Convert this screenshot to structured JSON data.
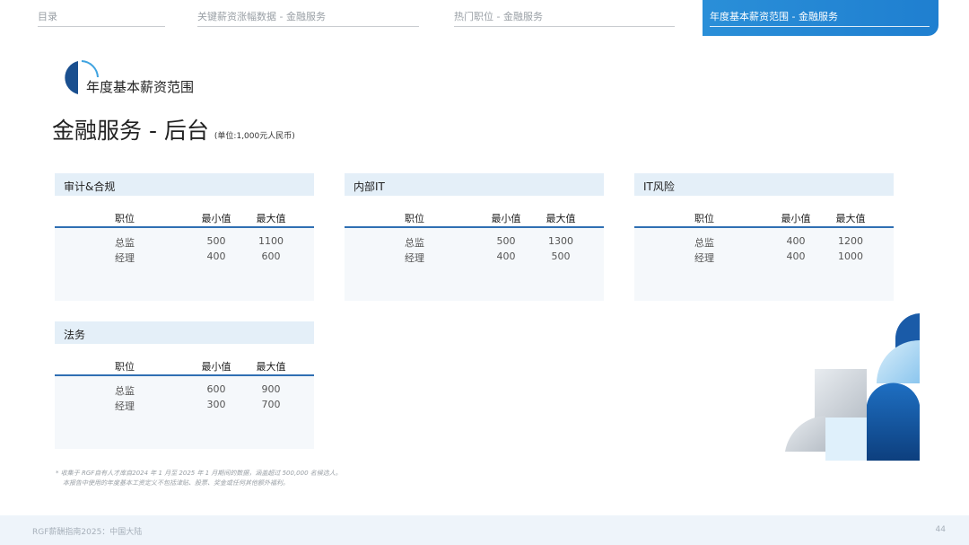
{
  "nav": {
    "tabs": [
      {
        "label": "目录"
      },
      {
        "label": "关键薪资涨幅数据 - 金融服务"
      },
      {
        "label": "热门职位 - 金融服务"
      },
      {
        "label": "年度基本薪资范围 - 金融服务"
      }
    ]
  },
  "section": {
    "title": "年度基本薪资范围"
  },
  "page": {
    "title": "金融服务 - 后台",
    "unit": "(单位:1,000元人民币)"
  },
  "columns": {
    "role": "职位",
    "min": "最小值",
    "max": "最大值"
  },
  "cards": [
    {
      "title": "审计&合规",
      "rows": [
        {
          "role": "总监",
          "min": "500",
          "max": "1100"
        },
        {
          "role": "经理",
          "min": "400",
          "max": "600"
        }
      ]
    },
    {
      "title": "内部IT",
      "rows": [
        {
          "role": "总监",
          "min": "500",
          "max": "1300"
        },
        {
          "role": "经理",
          "min": "400",
          "max": "500"
        }
      ]
    },
    {
      "title": "IT风险",
      "rows": [
        {
          "role": "总监",
          "min": "400",
          "max": "1200"
        },
        {
          "role": "经理",
          "min": "400",
          "max": "1000"
        }
      ]
    },
    {
      "title": "法务",
      "rows": [
        {
          "role": "总监",
          "min": "600",
          "max": "900"
        },
        {
          "role": "经理",
          "min": "300",
          "max": "700"
        }
      ]
    }
  ],
  "footnote": {
    "line1": "* 收集于 RGF自有人才库自2024 年 1 月至 2025 年 1 月期间的数据，涵盖超过 500,000 名候选人。",
    "line2": "本报告中使用的年度基本工资定义不包括津贴、股票、奖金或任何其他额外福利。"
  },
  "footer": {
    "text": "RGF薪酬指南2025：中国大陆",
    "page_number": "44"
  },
  "colors": {
    "accent": "#1f7fd0",
    "header_bg": "#e4eff8",
    "line": "#2f6fb3",
    "card_bg": "#f5f8fb"
  }
}
